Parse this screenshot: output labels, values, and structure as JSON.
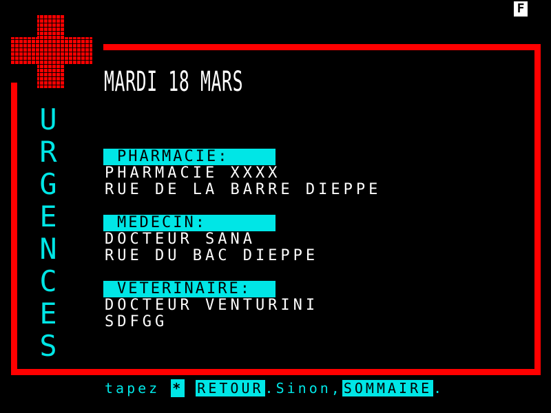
{
  "page_indicator": "F",
  "vertical_title": [
    "U",
    "R",
    "G",
    "E",
    "N",
    "C",
    "E",
    "S"
  ],
  "date": "MARDI 18 MARS",
  "sections": [
    {
      "label": "PHARMACIE:",
      "lines": [
        "PHARMACIE XXXX",
        "RUE DE LA BARRE DIEPPE"
      ]
    },
    {
      "label": "MEDECIN:",
      "lines": [
        "DOCTEUR SANA",
        "RUE DU BAC DIEPPE"
      ]
    },
    {
      "label": "VETERINAIRE:",
      "lines": [
        "DOCTEUR VENTURINI",
        "SDFGG"
      ]
    }
  ],
  "footer": {
    "prefix": "tapez ",
    "key": "*",
    "retour": "RETOUR",
    "middle": ".Sinon,",
    "sommaire": "SOMMAIRE",
    "suffix": "."
  },
  "colors": {
    "frame": "#ff0000",
    "accent": "#00e6e6",
    "text": "#ffffff",
    "background": "#000000"
  },
  "icons": {
    "logo": "red-cross-icon"
  }
}
